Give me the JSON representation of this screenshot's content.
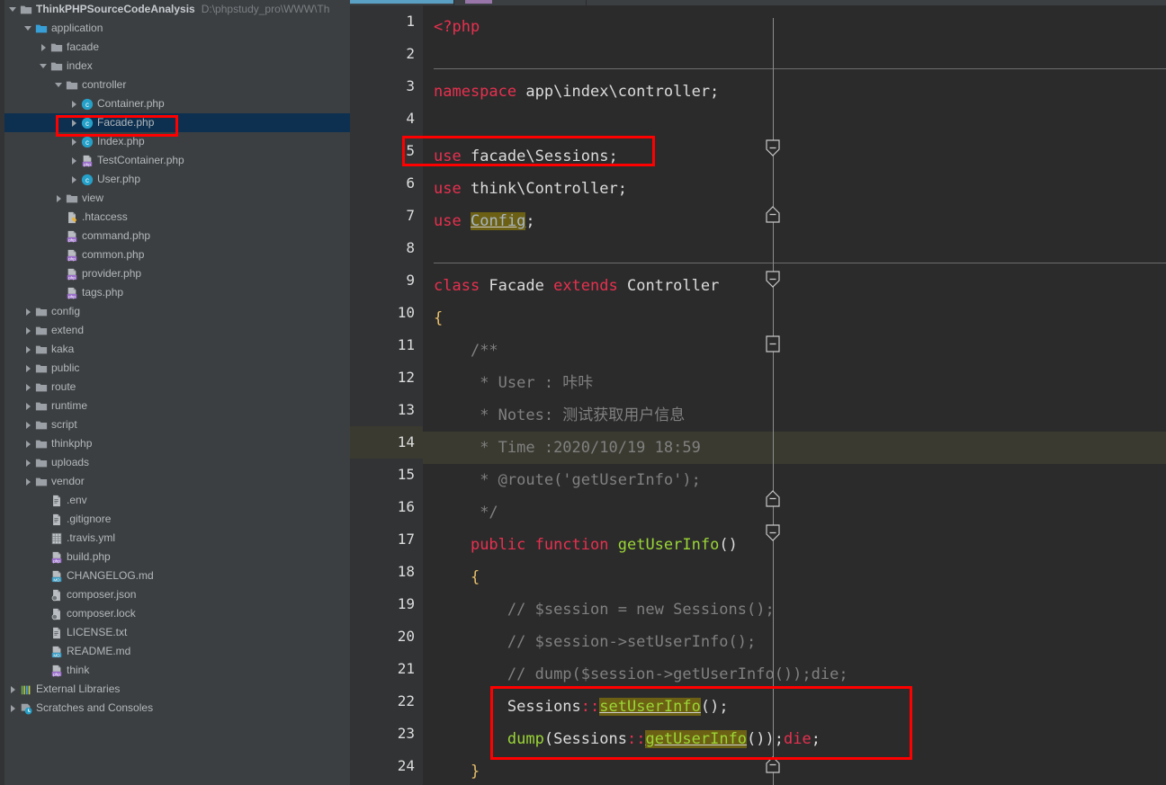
{
  "window": {
    "theme_bg": "#3c3f41",
    "editor_bg": "#2b2b2b",
    "gutter_bg": "#313335",
    "selection_bg": "#0d3050",
    "caret_line_bg": "#3a3a30",
    "annotation_color": "#ff0000",
    "accent_tab": "#5a9fc4"
  },
  "sidebar": {
    "root": {
      "label": "ThinkPHPSourceCodeAnalysis",
      "path": "D:\\phpstudy_pro\\WWW\\Th",
      "icon": "folder-icon",
      "arrow": "chevron-down-icon"
    },
    "items": [
      {
        "label": "application",
        "indent": 1,
        "arrow": "down",
        "icon": "folder-blue-icon",
        "selected": false
      },
      {
        "label": "facade",
        "indent": 2,
        "arrow": "right",
        "icon": "folder-icon",
        "selected": false
      },
      {
        "label": "index",
        "indent": 2,
        "arrow": "down",
        "icon": "folder-icon",
        "selected": false
      },
      {
        "label": "controller",
        "indent": 3,
        "arrow": "down",
        "icon": "folder-icon",
        "selected": false
      },
      {
        "label": "Container.php",
        "indent": 4,
        "arrow": "right",
        "icon": "php-class-icon",
        "selected": false
      },
      {
        "label": "Facade.php",
        "indent": 4,
        "arrow": "right",
        "icon": "php-class-icon",
        "selected": true
      },
      {
        "label": "Index.php",
        "indent": 4,
        "arrow": "right",
        "icon": "php-class-icon",
        "selected": false
      },
      {
        "label": "TestContainer.php",
        "indent": 4,
        "arrow": "right",
        "icon": "php-file-icon",
        "selected": false
      },
      {
        "label": "User.php",
        "indent": 4,
        "arrow": "right",
        "icon": "php-class-icon",
        "selected": false
      },
      {
        "label": "view",
        "indent": 3,
        "arrow": "right",
        "icon": "folder-icon",
        "selected": false
      },
      {
        "label": ".htaccess",
        "indent": 3,
        "arrow": "none",
        "icon": "htaccess-icon",
        "selected": false
      },
      {
        "label": "command.php",
        "indent": 3,
        "arrow": "none",
        "icon": "php-file-icon",
        "selected": false
      },
      {
        "label": "common.php",
        "indent": 3,
        "arrow": "none",
        "icon": "php-file-icon",
        "selected": false
      },
      {
        "label": "provider.php",
        "indent": 3,
        "arrow": "none",
        "icon": "php-file-icon",
        "selected": false
      },
      {
        "label": "tags.php",
        "indent": 3,
        "arrow": "none",
        "icon": "php-file-icon",
        "selected": false
      },
      {
        "label": "config",
        "indent": 1,
        "arrow": "right",
        "icon": "folder-icon",
        "selected": false
      },
      {
        "label": "extend",
        "indent": 1,
        "arrow": "right",
        "icon": "folder-icon",
        "selected": false
      },
      {
        "label": "kaka",
        "indent": 1,
        "arrow": "right",
        "icon": "folder-icon",
        "selected": false
      },
      {
        "label": "public",
        "indent": 1,
        "arrow": "right",
        "icon": "folder-icon",
        "selected": false
      },
      {
        "label": "route",
        "indent": 1,
        "arrow": "right",
        "icon": "folder-icon",
        "selected": false
      },
      {
        "label": "runtime",
        "indent": 1,
        "arrow": "right",
        "icon": "folder-icon",
        "selected": false
      },
      {
        "label": "script",
        "indent": 1,
        "arrow": "right",
        "icon": "folder-icon",
        "selected": false
      },
      {
        "label": "thinkphp",
        "indent": 1,
        "arrow": "right",
        "icon": "folder-icon",
        "selected": false
      },
      {
        "label": "uploads",
        "indent": 1,
        "arrow": "right",
        "icon": "folder-icon",
        "selected": false
      },
      {
        "label": "vendor",
        "indent": 1,
        "arrow": "right",
        "icon": "folder-icon",
        "selected": false
      },
      {
        "label": ".env",
        "indent": 2,
        "arrow": "none",
        "icon": "text-file-icon",
        "selected": false
      },
      {
        "label": ".gitignore",
        "indent": 2,
        "arrow": "none",
        "icon": "text-file-icon",
        "selected": false
      },
      {
        "label": ".travis.yml",
        "indent": 2,
        "arrow": "none",
        "icon": "yaml-file-icon",
        "selected": false
      },
      {
        "label": "build.php",
        "indent": 2,
        "arrow": "none",
        "icon": "php-file-icon",
        "selected": false
      },
      {
        "label": "CHANGELOG.md",
        "indent": 2,
        "arrow": "none",
        "icon": "markdown-file-icon",
        "selected": false
      },
      {
        "label": "composer.json",
        "indent": 2,
        "arrow": "none",
        "icon": "composer-file-icon",
        "selected": false
      },
      {
        "label": "composer.lock",
        "indent": 2,
        "arrow": "none",
        "icon": "composer-file-icon",
        "selected": false
      },
      {
        "label": "LICENSE.txt",
        "indent": 2,
        "arrow": "none",
        "icon": "text-file-icon",
        "selected": false
      },
      {
        "label": "README.md",
        "indent": 2,
        "arrow": "none",
        "icon": "markdown-file-icon",
        "selected": false
      },
      {
        "label": "think",
        "indent": 2,
        "arrow": "none",
        "icon": "php-file-icon",
        "selected": false
      },
      {
        "label": "External Libraries",
        "indent": 0,
        "arrow": "right",
        "icon": "libraries-icon",
        "selected": false
      },
      {
        "label": "Scratches and Consoles",
        "indent": 0,
        "arrow": "right",
        "icon": "scratches-icon",
        "selected": false
      }
    ]
  },
  "editor": {
    "filename": "Facade.php",
    "language": "php",
    "caret_line": 14,
    "first_line": 1,
    "last_line": 24,
    "lines": [
      {
        "n": 1,
        "text": "<?php"
      },
      {
        "n": 2,
        "text": ""
      },
      {
        "n": 3,
        "text": "namespace app\\index\\controller;"
      },
      {
        "n": 4,
        "text": ""
      },
      {
        "n": 5,
        "text": "use facade\\Sessions;"
      },
      {
        "n": 6,
        "text": "use think\\Controller;"
      },
      {
        "n": 7,
        "text": "use Config;"
      },
      {
        "n": 8,
        "text": ""
      },
      {
        "n": 9,
        "text": "class Facade extends Controller"
      },
      {
        "n": 10,
        "text": "{"
      },
      {
        "n": 11,
        "text": "    /**"
      },
      {
        "n": 12,
        "text": "     * User : 咔咔"
      },
      {
        "n": 13,
        "text": "     * Notes: 测试获取用户信息"
      },
      {
        "n": 14,
        "text": "     * Time :2020/10/19 18:59"
      },
      {
        "n": 15,
        "text": "     * @route('getUserInfo');"
      },
      {
        "n": 16,
        "text": "     */"
      },
      {
        "n": 17,
        "text": "    public function getUserInfo()"
      },
      {
        "n": 18,
        "text": "    {"
      },
      {
        "n": 19,
        "text": "        // $session = new Sessions();"
      },
      {
        "n": 20,
        "text": "        // $session->setUserInfo();"
      },
      {
        "n": 21,
        "text": "        // dump($session->getUserInfo());die;"
      },
      {
        "n": 22,
        "text": "        Sessions::setUserInfo();"
      },
      {
        "n": 23,
        "text": "        dump(Sessions::getUserInfo());die;"
      },
      {
        "n": 24,
        "text": "    }"
      }
    ]
  },
  "annotations": [
    {
      "name": "highlight-facade-php-tree-item",
      "target": "Facade.php tree row"
    },
    {
      "name": "highlight-use-facade-sessions",
      "target": "line 5: use facade\\Sessions;"
    },
    {
      "name": "highlight-sessions-calls",
      "target": "lines 22-23: Sessions::setUserInfo(); / dump(Sessions::getUserInfo());die;"
    }
  ]
}
